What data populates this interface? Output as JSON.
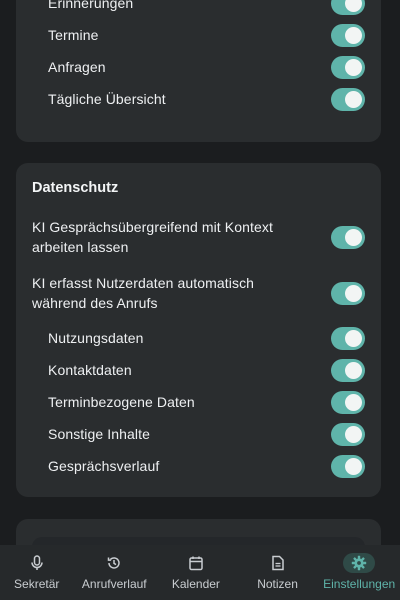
{
  "notifications": {
    "items": [
      {
        "label": "Erinnerungen",
        "on": true
      },
      {
        "label": "Termine",
        "on": true
      },
      {
        "label": "Anfragen",
        "on": true
      },
      {
        "label": "Tägliche Übersicht",
        "on": true
      }
    ]
  },
  "privacy": {
    "title": "Datenschutz",
    "context_label": "KI Gesprächsübergreifend mit Kontext arbeiten lassen",
    "context_on": true,
    "capture_label": "KI erfasst Nutzerdaten automatisch während des Anrufs",
    "capture_on": true,
    "items": [
      {
        "label": "Nutzungsdaten",
        "on": true
      },
      {
        "label": "Kontaktdaten",
        "on": true
      },
      {
        "label": "Terminbezogene Daten",
        "on": true
      },
      {
        "label": "Sonstige Inhalte",
        "on": true
      },
      {
        "label": "Gesprächsverlauf",
        "on": true
      }
    ]
  },
  "nav": {
    "items": [
      {
        "label": "Sekretär",
        "icon": "microphone-icon"
      },
      {
        "label": "Anrufverlauf",
        "icon": "history-icon"
      },
      {
        "label": "Kalender",
        "icon": "calendar-icon"
      },
      {
        "label": "Notizen",
        "icon": "notes-icon"
      },
      {
        "label": "Einstellungen",
        "icon": "gear-icon",
        "active": true
      }
    ]
  },
  "colors": {
    "accent": "#5fb4aa",
    "background": "#1b1d1f",
    "card": "#2a2d2f"
  }
}
